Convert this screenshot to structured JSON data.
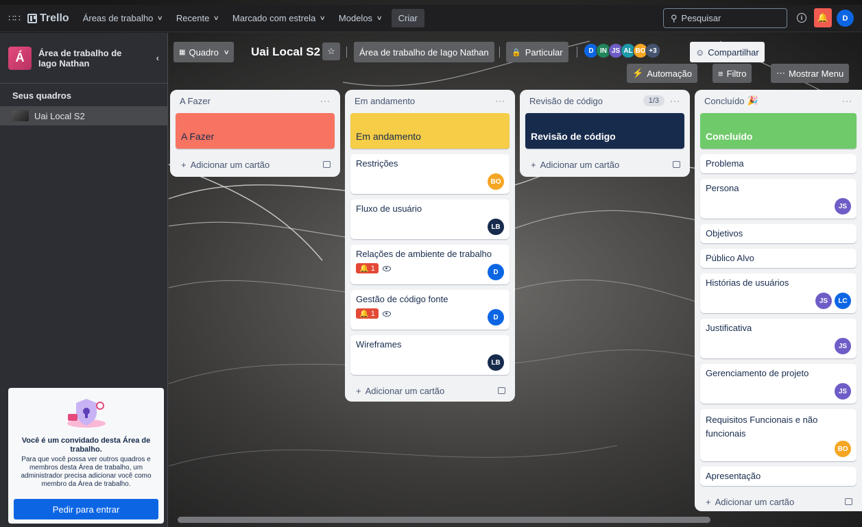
{
  "nav": {
    "brand": "Trello",
    "items": [
      "Áreas de trabalho",
      "Recente",
      "Marcado com estrela",
      "Modelos"
    ],
    "create": "Criar",
    "search_placeholder": "Pesquisar",
    "info_icon": "info-icon",
    "notification_icon": "bell-icon",
    "user_initial": "D",
    "colors": {
      "notification": "#f15b50",
      "user": "#0c66e4"
    }
  },
  "sidebar": {
    "workspace_initial": "Á",
    "workspace_name": "Área de trabalho de Iago Nathan",
    "section_title": "Seus quadros",
    "boards": [
      "Uai Local S2"
    ],
    "guest_title": "Você é um convidado desta Área de trabalho.",
    "guest_text": "Para que você possa ver outros quadros e membros desta Área de trabalho, um administrador precisa adicionar você como membro da Área de trabalho.",
    "ask_button": "Pedir para entrar"
  },
  "board": {
    "view": "Quadro",
    "title": "Uai Local S2",
    "workspace_link": "Área de trabalho de Iago Nathan",
    "privacy": "Particular",
    "members": [
      {
        "initials": "D",
        "color": "#0c66e4"
      },
      {
        "initials": "IN",
        "color": "#1f845a"
      },
      {
        "initials": "JS",
        "color": "#6e5dc6"
      },
      {
        "initials": "AL",
        "color": "#1d9aaa"
      },
      {
        "initials": "BO",
        "color": "#f5a623"
      }
    ],
    "more_members": "+3",
    "share": "Compartilhar",
    "automation": "Automação",
    "filter": "Filtro",
    "show_menu": "Mostrar Menu"
  },
  "lists": [
    {
      "title": "A Fazer",
      "cover": {
        "label": "A Fazer",
        "color": "#f87462"
      },
      "cards": [],
      "add_card": "Adicionar um cartão"
    },
    {
      "title": "Em andamento",
      "cover": {
        "label": "Em andamento",
        "color": "#f5cd47"
      },
      "cards": [
        {
          "title": "Restrições",
          "members": [
            "BO"
          ]
        },
        {
          "title": "Fluxo de usuário",
          "members": [
            "LB"
          ]
        },
        {
          "title": "Relações de ambiente de trabalho",
          "notifications": "1",
          "members": [
            "D"
          ]
        },
        {
          "title": "Gestão de código fonte",
          "notifications": "1",
          "members": [
            "D"
          ]
        },
        {
          "title": "Wireframes",
          "members": [
            "LB"
          ]
        }
      ],
      "add_card": "Adicionar um cartão"
    },
    {
      "title": "Revisão de código",
      "count": "1/3",
      "cover": {
        "label": "Revisão de código",
        "color": "#172b4d"
      },
      "cards": [],
      "add_card": "Adicionar um cartão"
    },
    {
      "title": "Concluído",
      "cover": {
        "label": "Concluído",
        "color": "#7ee2b8"
      },
      "cards": [
        {
          "title": "Problema",
          "members": []
        },
        {
          "title": "Persona",
          "members": [
            "JS"
          ]
        },
        {
          "title": "Objetivos",
          "members": []
        },
        {
          "title": "Público Alvo",
          "members": []
        },
        {
          "title": "Histórias de usuários",
          "members": [
            "JS",
            "LC"
          ]
        },
        {
          "title": "Justificativa",
          "members": [
            "JS"
          ]
        },
        {
          "title": "Gerenciamento de projeto",
          "members": [
            "JS"
          ]
        },
        {
          "title": "Requisitos Funcionais e não funcionais",
          "members": [
            "BO"
          ]
        },
        {
          "title": "Apresentação",
          "members": []
        }
      ],
      "add_card": "Adicionar um cartão"
    }
  ],
  "avatar_colors": {
    "BO": "#f5a623",
    "LB": "#172b4d",
    "D": "#0c66e4",
    "JS": "#6e5dc6",
    "LC": "#0c66e4"
  }
}
